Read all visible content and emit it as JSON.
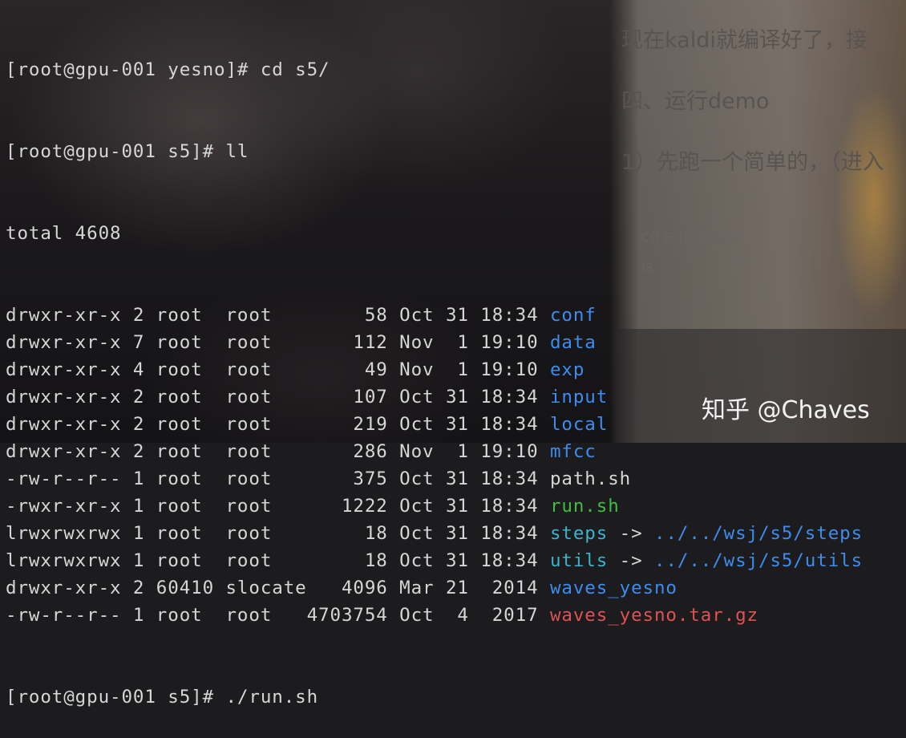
{
  "background_document": {
    "line1": "现在kaldi就编译好了，接",
    "line2": "四、运行demo",
    "line3": "1）先跑一个简单的，（进入",
    "code1": "cd egs/yesno",
    "code2": "ls"
  },
  "terminal": {
    "prompt1": "[root@gpu-001 yesno]# ",
    "cmd1": "cd s5/",
    "prompt2": "[root@gpu-001 s5]# ",
    "cmd2": "ll",
    "total": "total 4608",
    "arrow": " -> ",
    "entries": [
      {
        "meta": "drwxr-xr-x 2 root  root        58 Oct 31 18:34 ",
        "name": "conf",
        "type": "dir"
      },
      {
        "meta": "drwxr-xr-x 7 root  root       112 Nov  1 19:10 ",
        "name": "data",
        "type": "dir"
      },
      {
        "meta": "drwxr-xr-x 4 root  root        49 Nov  1 19:10 ",
        "name": "exp",
        "type": "dir"
      },
      {
        "meta": "drwxr-xr-x 2 root  root       107 Oct 31 18:34 ",
        "name": "input",
        "type": "dir"
      },
      {
        "meta": "drwxr-xr-x 2 root  root       219 Oct 31 18:34 ",
        "name": "local",
        "type": "dir"
      },
      {
        "meta": "drwxr-xr-x 2 root  root       286 Nov  1 19:10 ",
        "name": "mfcc",
        "type": "dir"
      },
      {
        "meta": "-rw-r--r-- 1 root  root       375 Oct 31 18:34 ",
        "name": "path.sh",
        "type": "file"
      },
      {
        "meta": "-rwxr-xr-x 1 root  root      1222 Oct 31 18:34 ",
        "name": "run.sh",
        "type": "exec"
      },
      {
        "meta": "lrwxrwxrwx 1 root  root        18 Oct 31 18:34 ",
        "name": "steps",
        "type": "link",
        "target": "../../wsj/s5/steps"
      },
      {
        "meta": "lrwxrwxrwx 1 root  root        18 Oct 31 18:34 ",
        "name": "utils",
        "type": "link",
        "target": "../../wsj/s5/utils"
      },
      {
        "meta": "drwxr-xr-x 2 60410 slocate   4096 Mar 21  2014 ",
        "name": "waves_yesno",
        "type": "dir"
      },
      {
        "meta": "-rw-r--r-- 1 root  root   4703754 Oct  4  2017 ",
        "name": "waves_yesno.tar.gz",
        "type": "archive"
      }
    ],
    "prompt3": "[root@gpu-001 s5]# ",
    "cmd3": "./run.sh"
  },
  "watermark": "知乎 @Chaves",
  "colors": {
    "dir": "#3d8cf0",
    "exec": "#3fbf3f",
    "link": "#38b4cf",
    "archive": "#e05252",
    "text": "#d6d6d6"
  }
}
